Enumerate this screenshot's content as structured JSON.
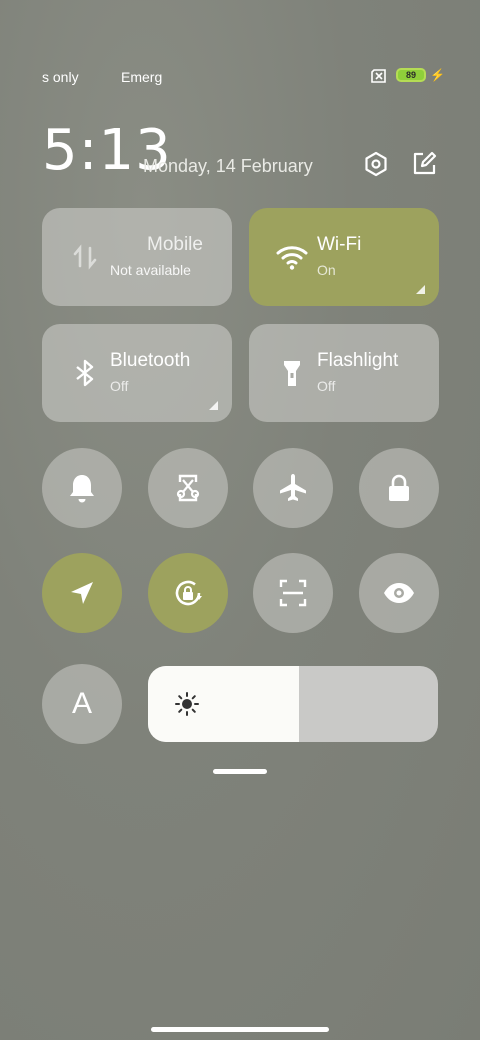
{
  "status_bar": {
    "carrier1": "s only",
    "carrier2": "Emerg",
    "battery_level": "89"
  },
  "header": {
    "time": "5:13",
    "date": "Monday, 14 February"
  },
  "tiles": [
    {
      "title": "Mobile",
      "subtitle": "Not available",
      "active": false,
      "icon": "mobile-data-icon"
    },
    {
      "title": "Wi-Fi",
      "subtitle": "On",
      "active": true,
      "icon": "wifi-icon"
    },
    {
      "title": "Bluetooth",
      "subtitle": "Off",
      "active": false,
      "icon": "bluetooth-icon"
    },
    {
      "title": "Flashlight",
      "subtitle": "Off",
      "active": false,
      "icon": "flashlight-icon"
    }
  ],
  "toggles_row1": [
    {
      "icon": "bell-icon",
      "active": false
    },
    {
      "icon": "screenshot-icon",
      "active": false
    },
    {
      "icon": "airplane-icon",
      "active": false
    },
    {
      "icon": "lock-icon",
      "active": false
    }
  ],
  "toggles_row2": [
    {
      "icon": "location-icon",
      "active": true
    },
    {
      "icon": "rotation-lock-icon",
      "active": true
    },
    {
      "icon": "scanner-icon",
      "active": false
    },
    {
      "icon": "eye-icon",
      "active": false
    }
  ],
  "auto_brightness_label": "A",
  "brightness": {
    "level": 0.52,
    "icon": "sun-icon"
  },
  "colors": {
    "accent": "#9da25e",
    "tile_off": "#b3b4ae"
  }
}
